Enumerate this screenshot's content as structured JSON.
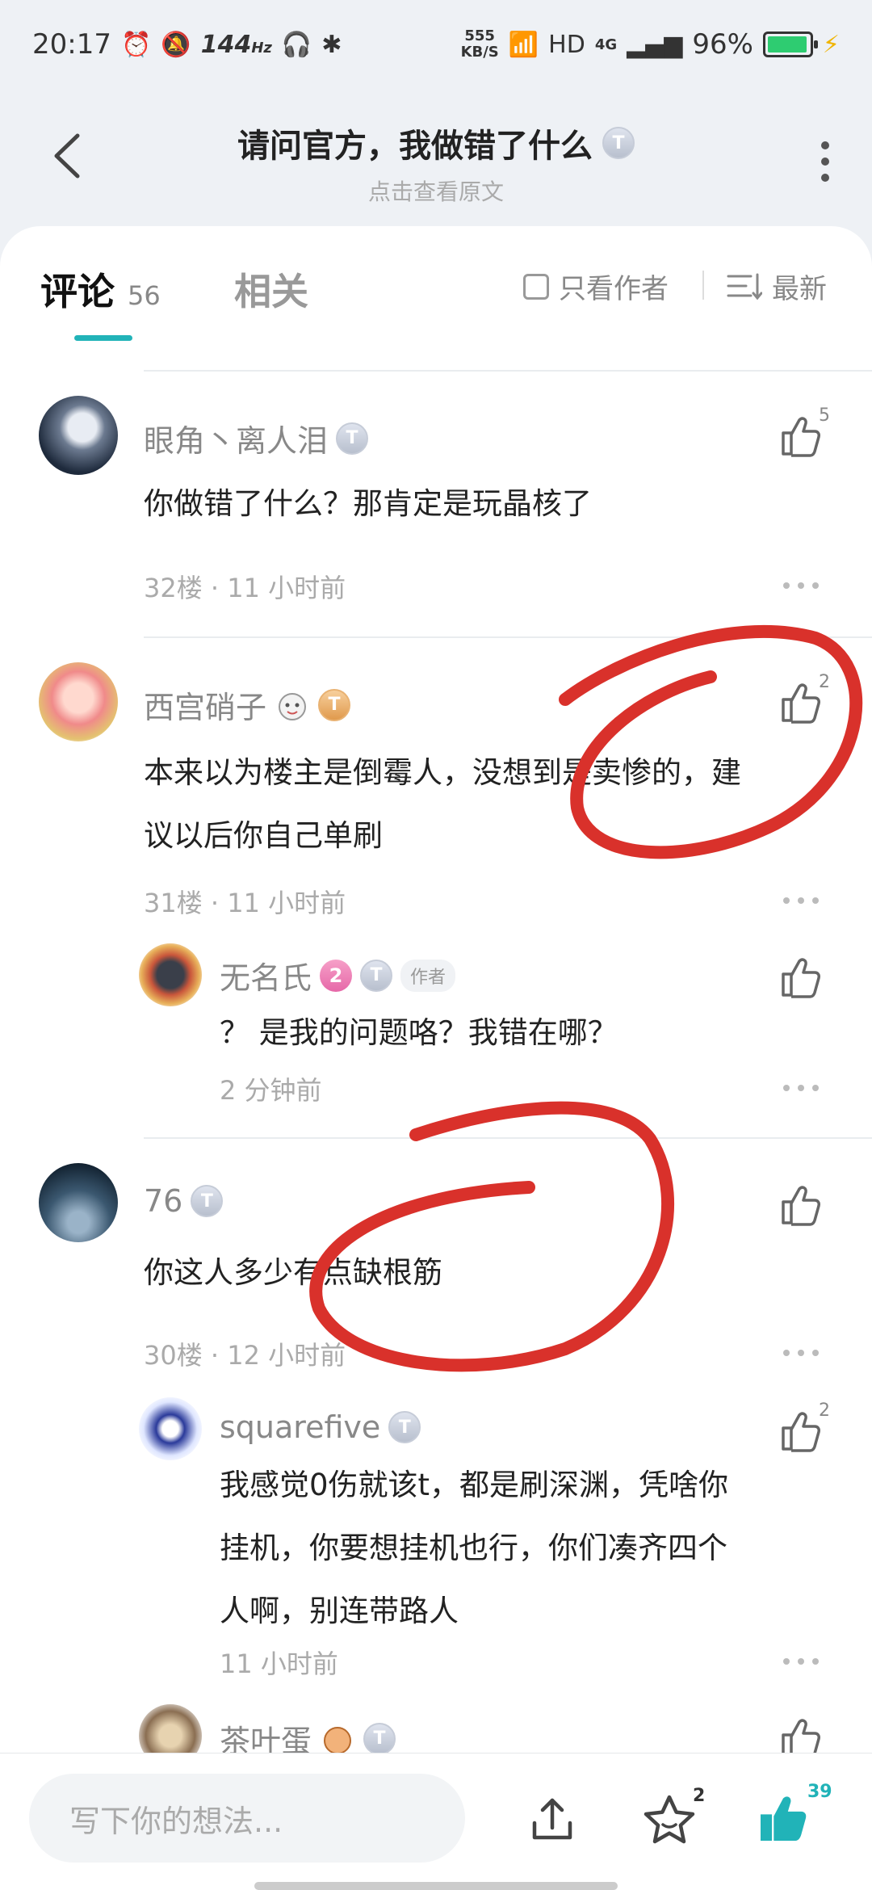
{
  "status_bar": {
    "time": "20:17",
    "refresh": "144",
    "refresh_unit": "Hz",
    "speed_value": "555",
    "speed_unit": "KB/S",
    "hd": "HD",
    "network": "4G",
    "battery": "96%"
  },
  "header": {
    "title": "请问官方，我做错了什么",
    "subtitle": "点击查看原文"
  },
  "tabs": {
    "comments_label": "评论",
    "comments_count": "56",
    "related_label": "相关",
    "author_only_label": "只看作者",
    "sort_label": "最新"
  },
  "comments": [
    {
      "user": "眼角丶离人泪",
      "text": "你做错了什么？那肯定是玩晶核了",
      "meta": "32楼 · 11 小时前",
      "likes": "5"
    },
    {
      "user": "西宫硝子",
      "text": "本来以为楼主是倒霉人，没想到是卖惨的，建议以后你自己单刷",
      "text_line1": "本来以为楼主是倒霉人，没想到是卖惨的，建",
      "text_line2": "议以后你自己单刷",
      "meta": "31楼 · 11 小时前",
      "likes": "2",
      "reply": {
        "user": "无名氏",
        "level": "2",
        "tag": "作者",
        "text": "？ 是我的问题咯？我错在哪？",
        "meta": "2 分钟前"
      }
    },
    {
      "user": "76",
      "text": "你这人多少有点缺根筋",
      "meta": "30楼 · 12 小时前",
      "likes": "",
      "reply": {
        "user": "squarefive",
        "text_line1": "我感觉0伤就该t，都是刷深渊，凭啥你",
        "text_line2": "挂机，你要想挂机也行，你们凑齐四个",
        "text_line3": "人啊，别连带路人",
        "meta": "11 小时前",
        "likes": "2"
      },
      "reply2": {
        "user": "茶叶蛋"
      }
    }
  ],
  "bottom_bar": {
    "input_placeholder": "写下你的想法...",
    "star_count": "2",
    "like_count": "39"
  },
  "colors": {
    "accent": "#21b3b8",
    "annotation": "#d9312b"
  }
}
